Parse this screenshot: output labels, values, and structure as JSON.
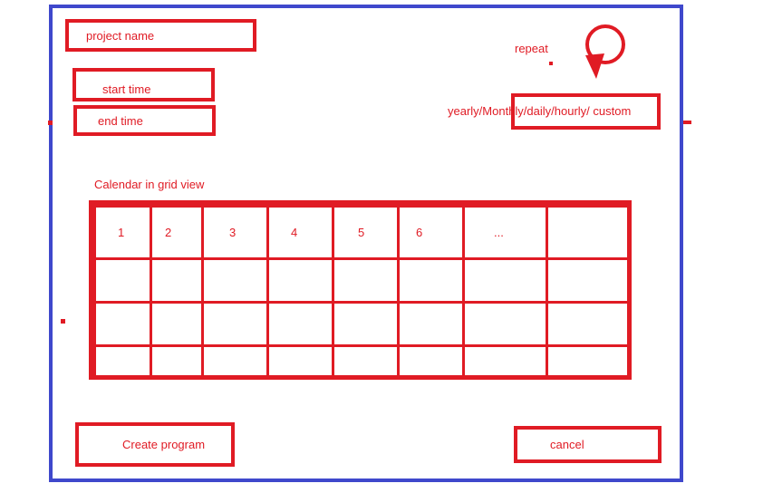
{
  "form": {
    "project_name_label": "project name",
    "start_time_label": "start time",
    "end_time_label": "end time"
  },
  "repeat": {
    "label": "repeat",
    "options_label": "yearly/Monthly/daily/hourly/ custom",
    "icon": "repeat-circle-icon"
  },
  "calendar": {
    "title": "Calendar in grid view",
    "header": [
      "1",
      "2",
      "3",
      "4",
      "5",
      "6",
      "...",
      ""
    ]
  },
  "actions": {
    "create_label": "Create program",
    "cancel_label": "cancel"
  },
  "colors": {
    "frame": "#3f48cc",
    "accent": "#e01b24"
  }
}
